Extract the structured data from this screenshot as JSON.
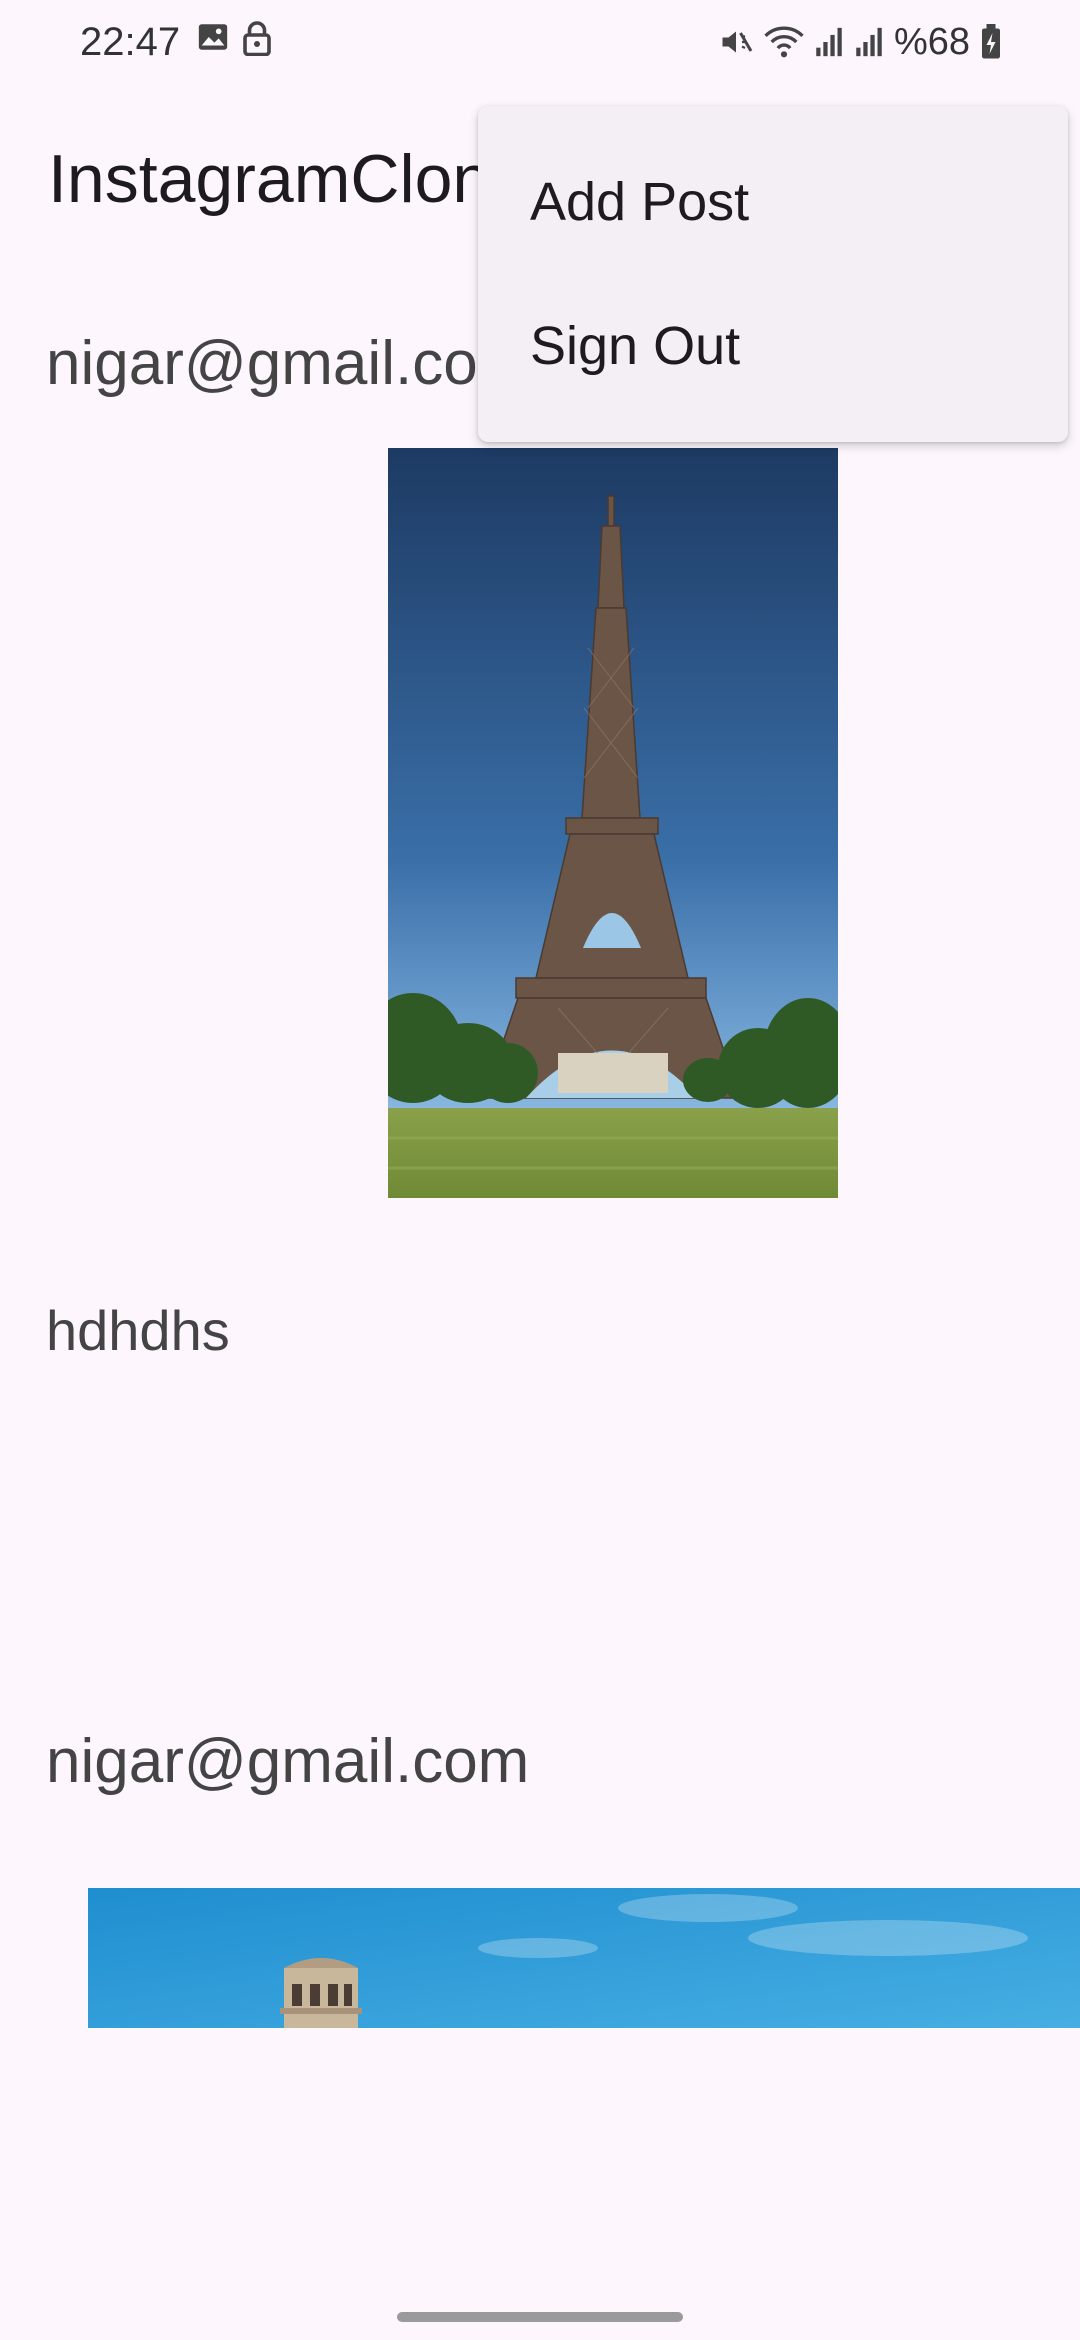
{
  "status_bar": {
    "time": "22:47",
    "battery_percent": "%68"
  },
  "app_bar": {
    "title": "InstagramClone"
  },
  "menu": {
    "items": [
      {
        "label": "Add Post"
      },
      {
        "label": "Sign Out"
      }
    ]
  },
  "feed": {
    "posts": [
      {
        "email": "nigar@gmail.com",
        "caption": "hdhdhs",
        "image": "eiffel-tower-photo"
      },
      {
        "email": "nigar@gmail.com",
        "caption": "",
        "image": "tower-against-blue-sky-photo"
      }
    ]
  },
  "colors": {
    "background": "#fdf7fd",
    "menu_background": "#f3eff4",
    "text_primary": "#1d1b20",
    "text_secondary": "#444444"
  }
}
